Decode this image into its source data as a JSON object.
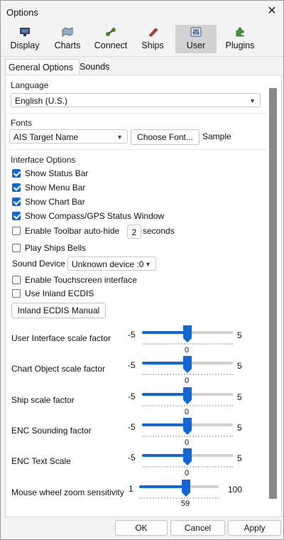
{
  "window": {
    "title": "Options"
  },
  "toolbar": [
    {
      "label": "Display",
      "icon": "monitor-icon"
    },
    {
      "label": "Charts",
      "icon": "charts-icon"
    },
    {
      "label": "Connect",
      "icon": "connect-icon"
    },
    {
      "label": "Ships",
      "icon": "ships-icon"
    },
    {
      "label": "User",
      "icon": "user-sliders-icon",
      "selected": true
    },
    {
      "label": "Plugins",
      "icon": "plugins-icon"
    }
  ],
  "tabs": [
    {
      "label": "General Options",
      "active": true
    },
    {
      "label": "Sounds",
      "active": false
    }
  ],
  "language": {
    "section": "Language",
    "value": "English (U.S.)"
  },
  "fonts": {
    "section": "Fonts",
    "value": "AIS Target Name",
    "button": "Choose Font...",
    "sample": "Sample"
  },
  "interface": {
    "section": "Interface Options",
    "checkboxes": [
      {
        "label": "Show Status Bar",
        "checked": true
      },
      {
        "label": "Show Menu Bar",
        "checked": true
      },
      {
        "label": "Show Chart Bar",
        "checked": true
      },
      {
        "label": "Show Compass/GPS Status Window",
        "checked": true
      },
      {
        "label": "Enable Toolbar auto-hide",
        "checked": false
      },
      {
        "label": "Play Ships Bells",
        "checked": false
      }
    ],
    "autohide_value": "2",
    "autohide_unit": "seconds",
    "sound_device_label": "Sound Device",
    "sound_device_value": "Unknown device :0",
    "checkboxes2": [
      {
        "label": "Enable Touchscreen interface",
        "checked": false
      },
      {
        "label": "Use Inland ECDIS",
        "checked": false
      }
    ],
    "inland_button": "Inland ECDIS Manual"
  },
  "scales": [
    {
      "label": "User Interface scale factor",
      "min": "-5",
      "max": "5",
      "value": "0",
      "fraction": 0.5
    },
    {
      "label": "Chart Object scale factor",
      "min": "-5",
      "max": "5",
      "value": "0",
      "fraction": 0.5
    },
    {
      "label": "Ship scale factor",
      "min": "-5",
      "max": "5",
      "value": "0",
      "fraction": 0.5
    },
    {
      "label": "ENC Sounding factor",
      "min": "-5",
      "max": "5",
      "value": "0",
      "fraction": 0.5
    },
    {
      "label": "ENC Text Scale",
      "min": "-5",
      "max": "5",
      "value": "0",
      "fraction": 0.5
    },
    {
      "label": "Mouse wheel zoom sensitivity",
      "min": "1",
      "max": "100",
      "value": "59",
      "fraction": 0.59
    }
  ],
  "footer": {
    "ok": "OK",
    "cancel": "Cancel",
    "apply": "Apply"
  },
  "colors": {
    "accent": "#1266d8",
    "window_bg": "#f3f3f3",
    "panel_bg": "#ffffff",
    "scrollbar": "#888888"
  }
}
